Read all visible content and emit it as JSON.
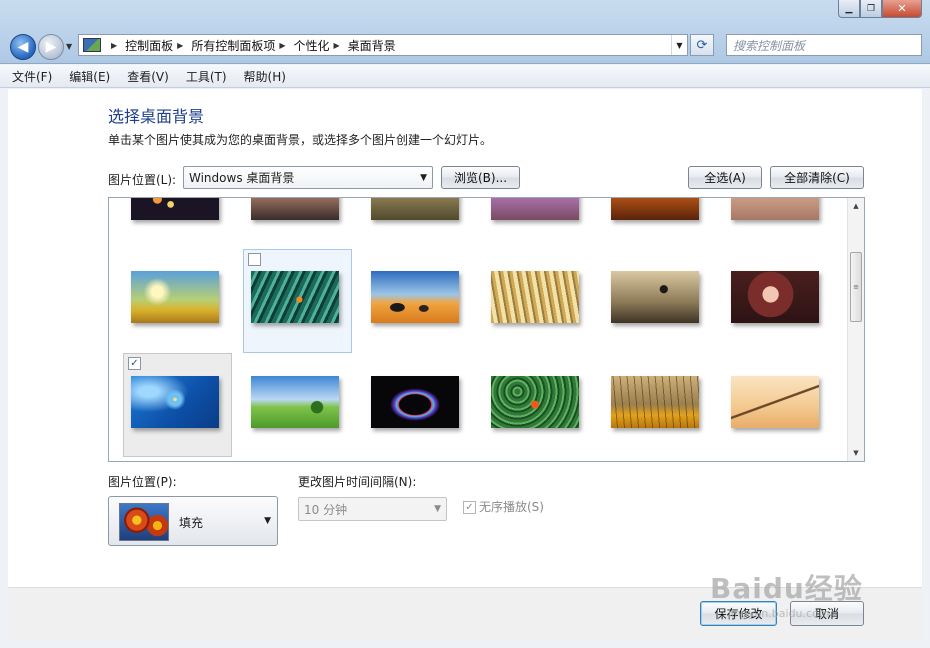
{
  "address": {
    "crumbs": [
      "控制面板",
      "所有控制面板项",
      "个性化",
      "桌面背景"
    ],
    "search_placeholder": "搜索控制面板"
  },
  "menu": [
    "文件(F)",
    "编辑(E)",
    "查看(V)",
    "工具(T)",
    "帮助(H)"
  ],
  "page": {
    "heading": "选择桌面背景",
    "subtitle": "单击某个图片使其成为您的桌面背景，或选择多个图片创建一个幻灯片。",
    "location_label": "图片位置(L):",
    "location_value": "Windows 桌面背景",
    "browse_label": "浏览(B)...",
    "select_all_label": "全选(A)",
    "clear_all_label": "全部清除(C)"
  },
  "gallery": {
    "rows": [
      [
        {
          "name": "bokeh-lights",
          "checked": false
        },
        {
          "name": "beach-sunset",
          "checked": false
        },
        {
          "name": "field-grass",
          "checked": false
        },
        {
          "name": "purple-wheat",
          "checked": false
        },
        {
          "name": "orange-reeds",
          "checked": false
        },
        {
          "name": "portrait-light",
          "checked": false
        }
      ],
      [
        {
          "name": "golden-field",
          "checked": false
        },
        {
          "name": "clownfish-anemone",
          "checked": false
        },
        {
          "name": "rocky-shore",
          "checked": false
        },
        {
          "name": "sunlit-grass",
          "checked": false
        },
        {
          "name": "bird-flight",
          "checked": false
        },
        {
          "name": "girl-portrait",
          "checked": false
        }
      ],
      [
        {
          "name": "windows7-logo",
          "checked": true
        },
        {
          "name": "green-hills",
          "checked": false
        },
        {
          "name": "neon-swirl",
          "checked": false
        },
        {
          "name": "clownfish-green",
          "checked": false
        },
        {
          "name": "wheat-sunset",
          "checked": false
        },
        {
          "name": "dry-branch",
          "checked": false
        }
      ]
    ]
  },
  "position": {
    "label": "图片位置(P):",
    "value": "填充"
  },
  "interval": {
    "label": "更改图片时间间隔(N):",
    "value": "10 分钟"
  },
  "shuffle": {
    "label": "无序播放(S)",
    "checked": true
  },
  "footer": {
    "save_label": "保存修改",
    "cancel_label": "取消"
  },
  "watermark": {
    "text": "Baidu经验",
    "sub": "jingyan.baidu.com"
  }
}
